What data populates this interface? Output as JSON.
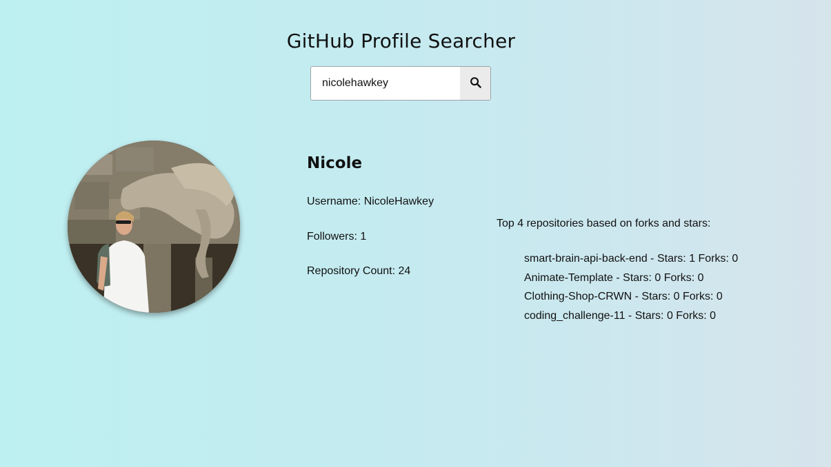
{
  "app": {
    "title": "GitHub Profile Searcher"
  },
  "search": {
    "value": "nicolehawkey",
    "button_icon": "search-icon"
  },
  "profile": {
    "avatar_icon": "avatar",
    "name": "Nicole",
    "username_text": "Username: NicoleHawkey",
    "followers_text": "Followers: 1",
    "repository_count_text": "Repository Count: 24"
  },
  "repositories": {
    "heading": "Top 4 repositories based on forks and stars:",
    "items": [
      {
        "text": "smart-brain-api-back-end - Stars: 1 Forks: 0"
      },
      {
        "text": "Animate-Template - Stars: 0 Forks: 0"
      },
      {
        "text": "Clothing-Shop-CRWN - Stars: 0 Forks: 0"
      },
      {
        "text": "coding_challenge-11 - Stars: 0 Forks: 0"
      }
    ]
  }
}
